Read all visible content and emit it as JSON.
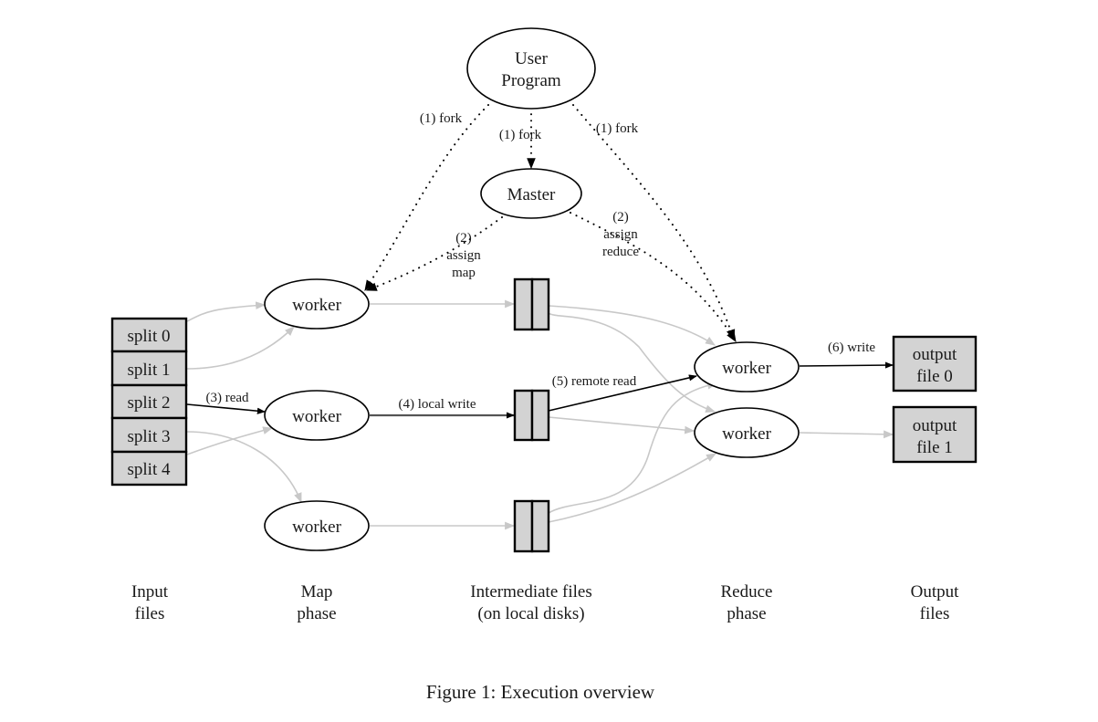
{
  "nodes": {
    "user_program": [
      "User",
      "Program"
    ],
    "master": "Master",
    "map_workers": [
      "worker",
      "worker",
      "worker"
    ],
    "reduce_workers": [
      "worker",
      "worker"
    ],
    "splits": [
      "split 0",
      "split 1",
      "split 2",
      "split 3",
      "split 4"
    ],
    "outputs": [
      [
        "output",
        "file 0"
      ],
      [
        "output",
        "file 1"
      ]
    ]
  },
  "edge_labels": {
    "fork_left": "(1) fork",
    "fork_center": "(1) fork",
    "fork_right": "(1) fork",
    "assign_map": [
      "(2)",
      "assign",
      "map"
    ],
    "assign_reduce": [
      "(2)",
      "assign",
      "reduce"
    ],
    "read": "(3) read",
    "local_write": "(4) local write",
    "remote_read": "(5) remote read",
    "write": "(6) write"
  },
  "phases": [
    [
      "Input",
      "files"
    ],
    [
      "Map",
      "phase"
    ],
    [
      "Intermediate files",
      "(on local disks)"
    ],
    [
      "Reduce",
      "phase"
    ],
    [
      "Output",
      "files"
    ]
  ],
  "caption": "Figure 1: Execution overview",
  "colors": {
    "box_fill": "#d3d3d3",
    "inactive_edge": "#c8c8c8",
    "active_edge": "#000000"
  }
}
